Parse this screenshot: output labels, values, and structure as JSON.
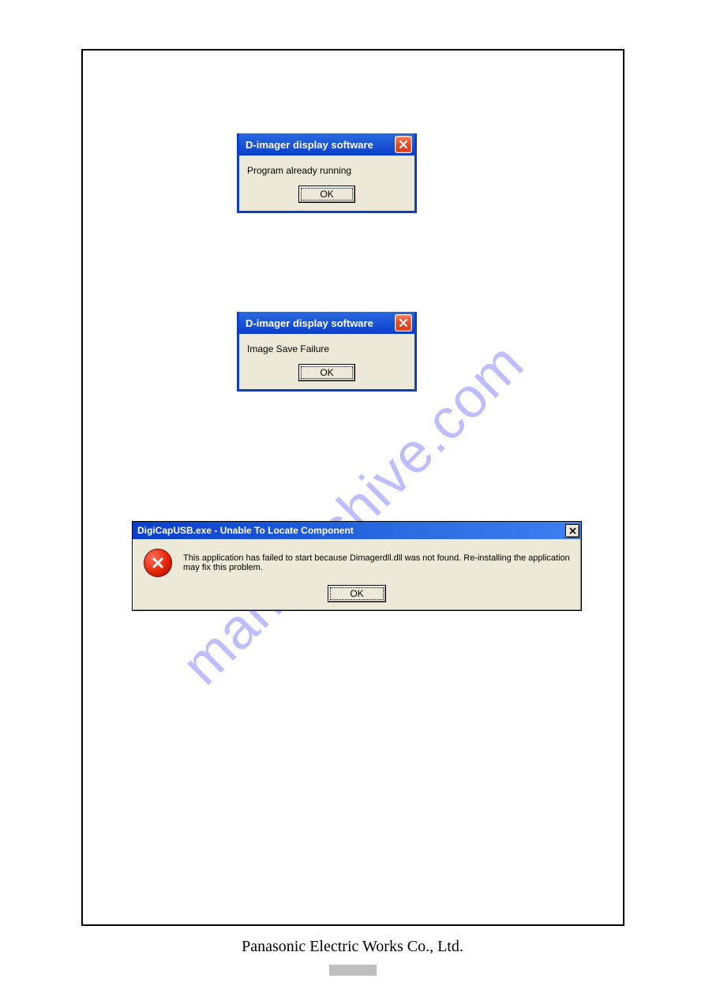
{
  "watermark": "manualshive.com",
  "footer": "Panasonic Electric Works Co., Ltd.",
  "dialog1": {
    "title": "D-imager display software",
    "message": "Program already running",
    "ok_label": "OK"
  },
  "dialog2": {
    "title": "D-imager display software",
    "message": "Image Save Failure",
    "ok_label": "OK"
  },
  "dialog3": {
    "title": "DigiCapUSB.exe - Unable To Locate Component",
    "message": "This application has failed to start because Dimagerdll.dll was not found. Re-installing the application may fix this problem.",
    "ok_label": "OK"
  }
}
